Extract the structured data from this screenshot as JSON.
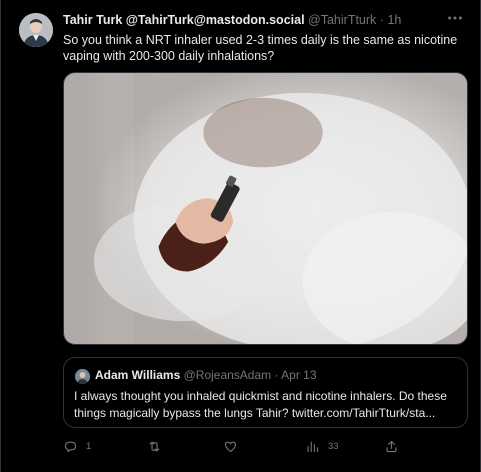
{
  "tweet": {
    "author_name": "Tahir Turk @TahirTurk@mastodon.social",
    "author_handle": "@TahirTturk",
    "separator": "·",
    "time": "1h",
    "text": "So you think a NRT inhaler used 2-3 times daily is the same as nicotine vaping with 200-300 daily inhalations?",
    "more_icon": "more-dots-icon"
  },
  "quoted_tweet": {
    "author_name": "Adam Williams",
    "author_handle": "@RojeansAdam",
    "separator": "·",
    "time": "Apr 13",
    "text": "I always thought you inhaled quickmist and nicotine inhalers. Do these things magically bypass the lungs Tahir? twitter.com/TahirTturk/sta..."
  },
  "actions": {
    "reply": {
      "icon": "reply-icon",
      "count": "1"
    },
    "retweet": {
      "icon": "retweet-icon",
      "count": ""
    },
    "like": {
      "icon": "heart-icon",
      "count": ""
    },
    "views": {
      "icon": "views-icon",
      "count": "33"
    },
    "share": {
      "icon": "share-icon",
      "count": ""
    }
  },
  "colors": {
    "background": "#000000",
    "text": "#e7e9ea",
    "secondary": "#71767b",
    "border": "#2f3336"
  }
}
